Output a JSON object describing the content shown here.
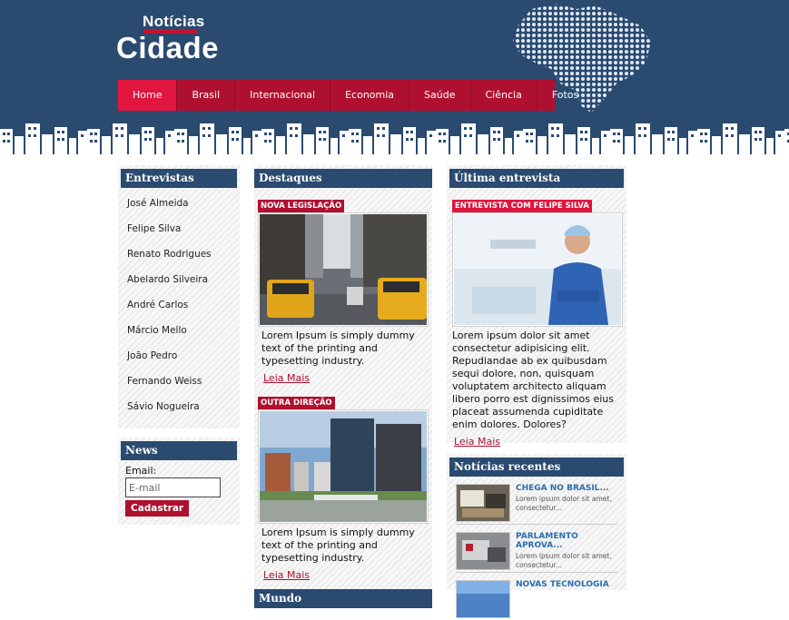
{
  "logo": {
    "top": "Notícias",
    "main": "Cidade"
  },
  "nav": {
    "items": [
      {
        "label": "Home"
      },
      {
        "label": "Brasil"
      },
      {
        "label": "Internacional"
      },
      {
        "label": "Economia"
      },
      {
        "label": "Saúde"
      },
      {
        "label": "Ciência"
      },
      {
        "label": "Fotos"
      }
    ]
  },
  "entrevistas": {
    "title": "Entrevistas",
    "names": [
      "José Almeida",
      "Felipe Silva",
      "Renato Rodrigues",
      "Abelardo Silveira",
      "André Carlos",
      "Márcio Mello",
      "João Pedro",
      "Fernando Weiss",
      "Sávio Nogueira"
    ]
  },
  "news": {
    "title": "News",
    "email_label": "Email:",
    "email_placeholder": "E-mail",
    "button": "Cadastrar"
  },
  "destaques": {
    "title": "Destaques",
    "stories": [
      {
        "tag": "NOVA LEGISLAÇÃO",
        "text": "Lorem Ipsum is simply dummy text of the printing and typesetting industry.",
        "link": "Leia Mais"
      },
      {
        "tag": "OUTRA DIREÇÃO",
        "text": "Lorem Ipsum is simply dummy text of the printing and typesetting industry.",
        "link": "Leia Mais"
      }
    ],
    "next_title": "Mundo"
  },
  "ultima": {
    "title": "Última entrevista",
    "tag": "ENTREVISTA COM FELIPE SILVA",
    "text": "Lorem ipsum dolor sit amet consectetur adipisicing elit. Repudiandae ab ex quibusdam sequi dolore, non, quisquam voluptatem architecto aliquam libero porro est dignissimos eius placeat assumenda cupiditate enim dolores. Dolores?",
    "link": "Leia Mais"
  },
  "recentes": {
    "title": "Notícias recentes",
    "items": [
      {
        "title": "CHEGA NO BRASIL...",
        "desc": "Lorem ipsum dolor sit amet, consectetur..."
      },
      {
        "title": "PARLAMENTO APROVA...",
        "desc": "Lorem ipsum dolor sit amet, consectetur..."
      },
      {
        "title": "NOVAS TECNOLOGIA",
        "desc": ""
      }
    ]
  },
  "colors": {
    "navy": "#2a4a70",
    "crimson": "#b0102f",
    "active_red": "#e0163e"
  }
}
